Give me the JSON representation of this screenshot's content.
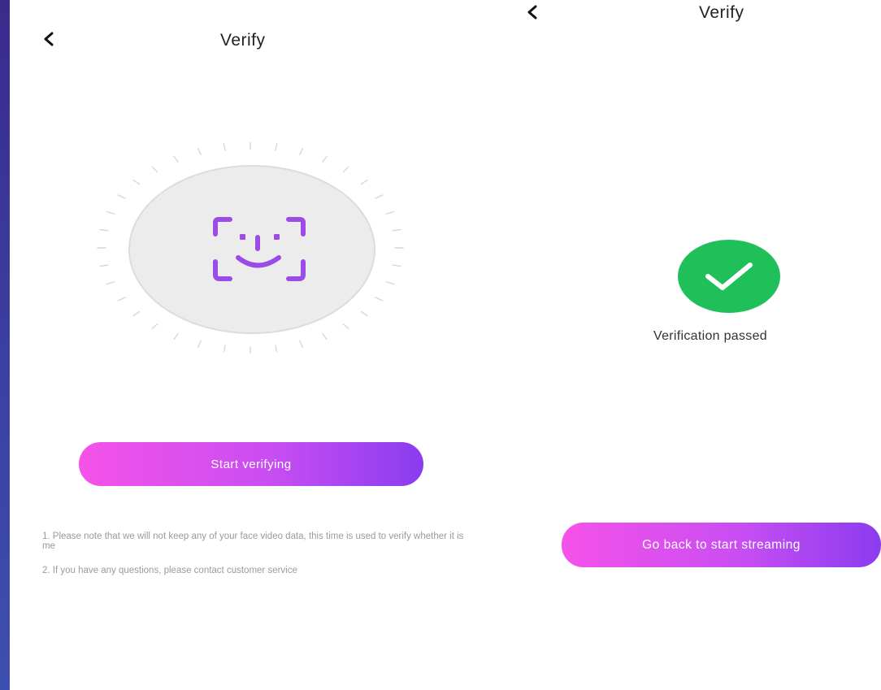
{
  "left_screen": {
    "back_icon": "chevron-left-icon",
    "title": "Verify",
    "face_icon": "face-scan-icon",
    "start_button": "Start verifying",
    "notes": [
      "1. Please note that we will not keep any of your face video data, this time is used to verify whether it is me",
      "2. If you have any questions, please contact customer service"
    ]
  },
  "right_screen": {
    "back_icon": "chevron-left-icon",
    "title": "Verify",
    "status_icon": "checkmark-icon",
    "status_text": "Verification passed",
    "back_button": "Go back to start streaming"
  },
  "colors": {
    "accent_gradient_start": "#f552e8",
    "accent_gradient_end": "#8a3cf0",
    "face_icon": "#9b4be6",
    "success": "#1fc05a",
    "edge_strip": "#3b3f9f"
  }
}
